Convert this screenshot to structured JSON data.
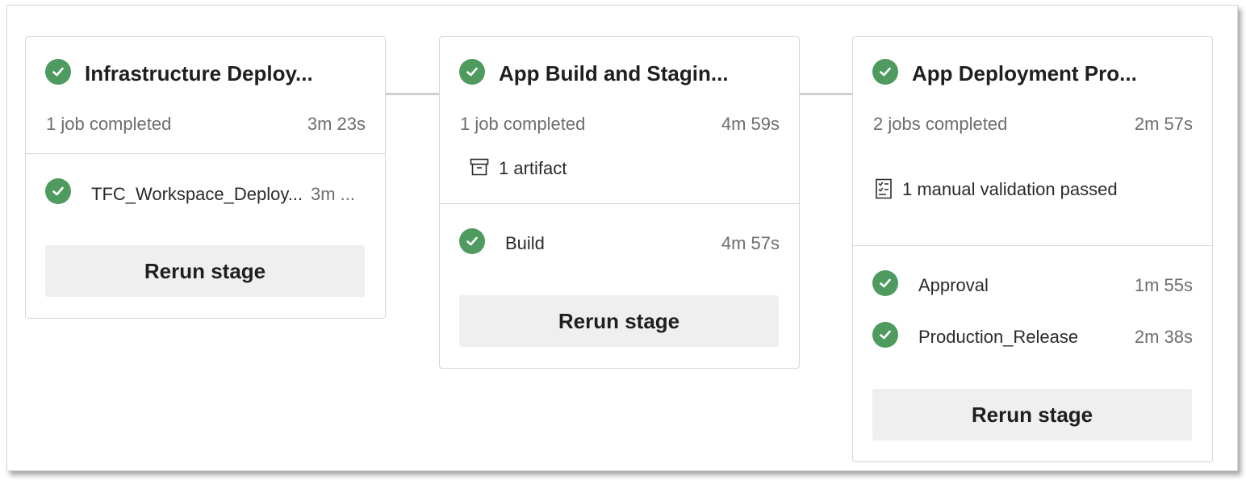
{
  "stages": [
    {
      "title": "Infrastructure Deploy...",
      "summary": "1 job completed",
      "duration": "3m 23s",
      "jobs": [
        {
          "name": "TFC_Workspace_Deploy...",
          "duration": "3m ..."
        }
      ],
      "rerun_label": "Rerun stage"
    },
    {
      "title": "App Build and Stagin...",
      "summary": "1 job completed",
      "duration": "4m 59s",
      "artifact_text": "1 artifact",
      "jobs": [
        {
          "name": "Build",
          "duration": "4m 57s"
        }
      ],
      "rerun_label": "Rerun stage"
    },
    {
      "title": "App Deployment Pro...",
      "summary": "2 jobs completed",
      "duration": "2m 57s",
      "validation_text": "1 manual validation passed",
      "jobs": [
        {
          "name": "Approval",
          "duration": "1m 55s"
        },
        {
          "name": "Production_Release",
          "duration": "2m 38s"
        }
      ],
      "rerun_label": "Rerun stage"
    }
  ],
  "colors": {
    "success": "#4e9a5f",
    "button_bg": "#efefef",
    "muted_text": "#6d6d6d"
  },
  "icons": {
    "status": "check-circle-icon",
    "artifact": "artifact-box-icon",
    "validation": "checklist-icon"
  }
}
